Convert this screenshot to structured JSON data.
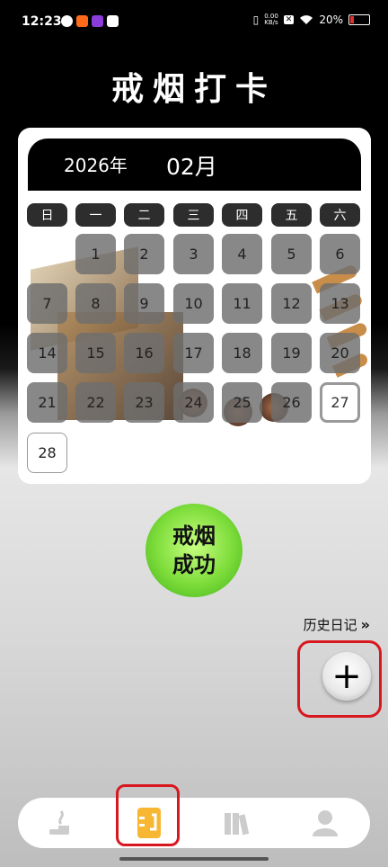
{
  "status_bar": {
    "time": "12:23",
    "net_speed_value": "0.00",
    "net_speed_unit": "KB/s",
    "battery": "20%",
    "battery_level": 0.2
  },
  "page": {
    "title": "戒烟打卡"
  },
  "calendar": {
    "year_label": "2026年",
    "month_label": "02月",
    "weekdays": [
      "日",
      "一",
      "二",
      "三",
      "四",
      "五",
      "六"
    ],
    "days": [
      "1",
      "2",
      "3",
      "4",
      "5",
      "6",
      "7",
      "8",
      "9",
      "10",
      "11",
      "12",
      "13",
      "14",
      "15",
      "16",
      "17",
      "18",
      "19",
      "20",
      "21",
      "22",
      "23",
      "24",
      "25",
      "26",
      "27",
      "28"
    ],
    "today": "27"
  },
  "badge": {
    "line1": "戒烟",
    "line2": "成功"
  },
  "history": {
    "label": "历史日记",
    "chevron": "»"
  },
  "add_button": {
    "symbol": "+"
  },
  "nav": {
    "items": [
      "smoking-icon",
      "cigarette-box-icon",
      "books-icon",
      "person-icon"
    ],
    "active": "cigarette-box-icon",
    "accent": "#f7b733"
  },
  "colors": {
    "highlight_frame": "#d8181f",
    "badge_green": "#7ddc3a"
  }
}
